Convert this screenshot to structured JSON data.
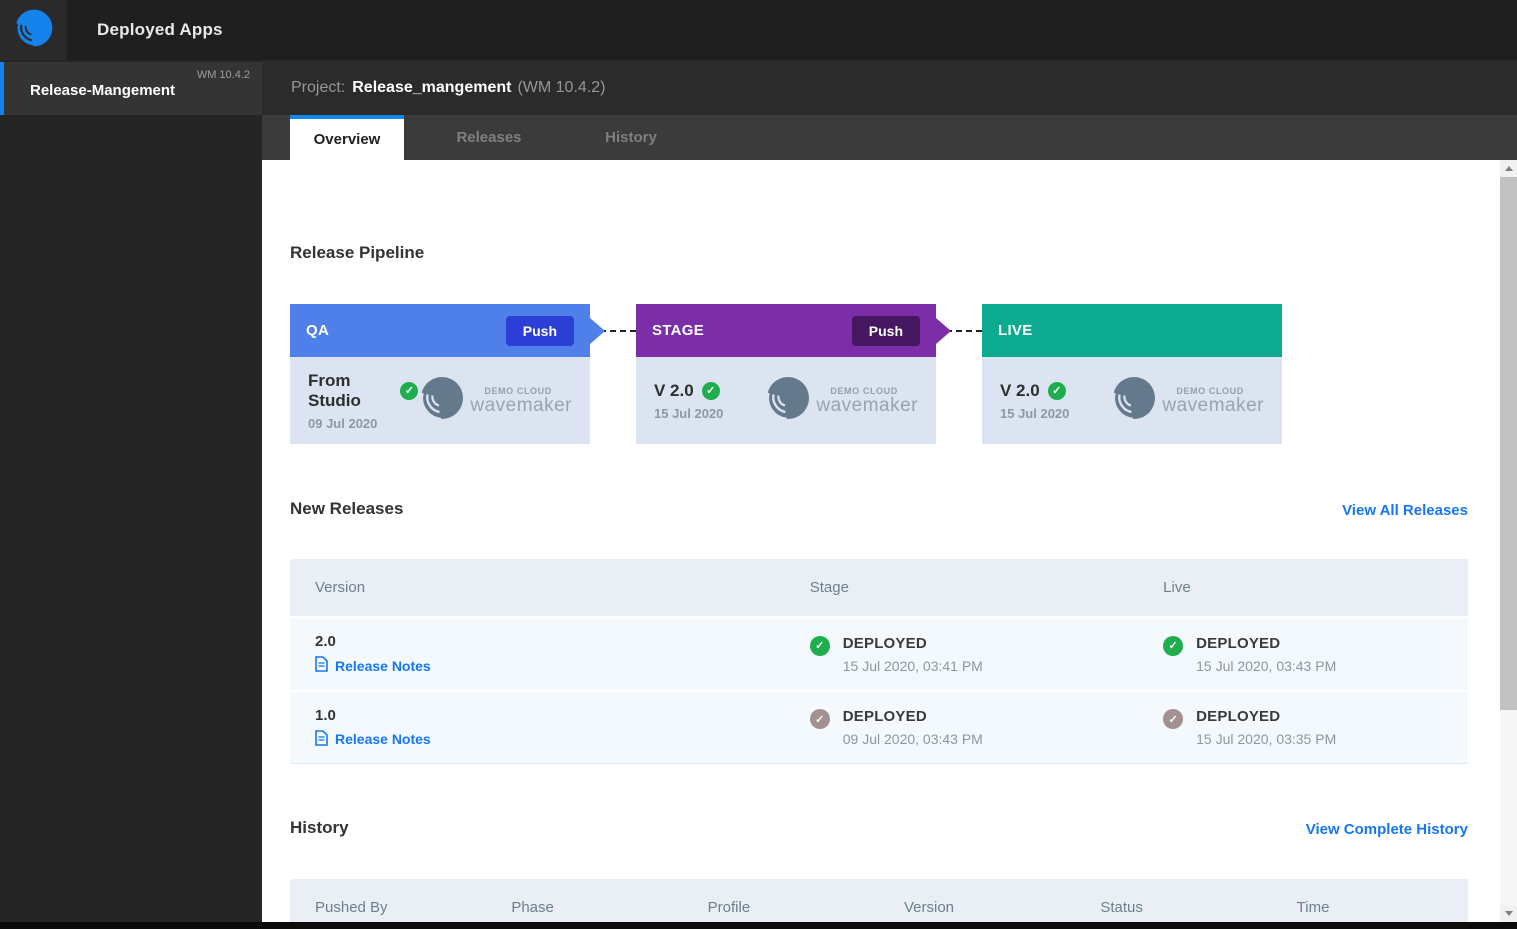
{
  "topbar": {
    "title": "Deployed Apps"
  },
  "sidebar": {
    "items": [
      {
        "label": "Release-Mangement",
        "version": "WM 10.4.2",
        "active": true
      }
    ]
  },
  "project_header": {
    "prefix": "Project:",
    "name": "Release_mangement",
    "version": "(WM 10.4.2)"
  },
  "tabs": [
    {
      "label": "Overview",
      "active": true
    },
    {
      "label": "Releases",
      "active": false
    },
    {
      "label": "History",
      "active": false
    }
  ],
  "pipeline": {
    "title": "Release Pipeline",
    "stages": [
      {
        "name": "QA",
        "push_label": "Push",
        "version": "From Studio",
        "date": "09 Jul 2020",
        "status_icon": "check-green"
      },
      {
        "name": "STAGE",
        "push_label": "Push",
        "version": "V 2.0",
        "date": "15 Jul 2020",
        "status_icon": "check-green"
      },
      {
        "name": "LIVE",
        "push_label": "",
        "version": "V 2.0",
        "date": "15 Jul 2020",
        "status_icon": "check-green"
      }
    ],
    "cloud_logo": {
      "top": "DEMO CLOUD",
      "bottom": "wavemaker"
    }
  },
  "new_releases": {
    "title": "New Releases",
    "view_all_label": "View All Releases",
    "columns": [
      "Version",
      "Stage",
      "Live"
    ],
    "rows": [
      {
        "version": "2.0",
        "release_notes_label": "Release Notes",
        "stage": {
          "status": "DEPLOYED",
          "time": "15 Jul 2020, 03:41 PM",
          "icon": "green"
        },
        "live": {
          "status": "DEPLOYED",
          "time": "15 Jul 2020, 03:43 PM",
          "icon": "green"
        }
      },
      {
        "version": "1.0",
        "release_notes_label": "Release Notes",
        "stage": {
          "status": "DEPLOYED",
          "time": "09 Jul 2020, 03:43 PM",
          "icon": "gray"
        },
        "live": {
          "status": "DEPLOYED",
          "time": "15 Jul 2020, 03:35 PM",
          "icon": "gray"
        }
      }
    ]
  },
  "history": {
    "title": "History",
    "view_all_label": "View Complete History",
    "columns": [
      "Pushed By",
      "Phase",
      "Profile",
      "Version",
      "Status",
      "Time"
    ]
  },
  "colors": {
    "accent_blue": "#1583eb",
    "qa_header": "#4f7fe8",
    "qa_push": "#2b3ed6",
    "stage_header": "#7b2ea8",
    "stage_push": "#451761",
    "live_header": "#0caa8e",
    "card_body": "#dbe4f0",
    "link_blue": "#1677f2",
    "check_green": "#1fad4e",
    "check_gray": "#a39090",
    "table_header_bg": "#e9eff4",
    "table_row_bg": "#f4f9fd"
  }
}
